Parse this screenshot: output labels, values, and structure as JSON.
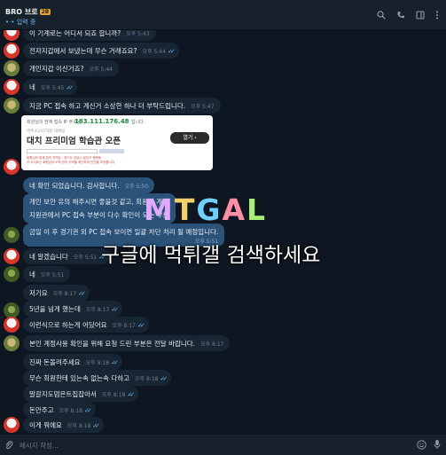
{
  "header": {
    "name": "BRO 브로",
    "badge": "2B",
    "status": "•·• 입력 중"
  },
  "messages": [
    {
      "dir": "in",
      "avatar": "a",
      "text": "이 기계로는 어디서 되죠 합니까?",
      "time": "오후 5:43"
    },
    {
      "dir": "in",
      "avatar": "a",
      "text": "전자지갑에서 보냈는데 무슨 거래죠요?",
      "time": "오후 5:44"
    },
    {
      "dir": "in",
      "avatar": "b",
      "text": "개인지갑 이신거죠?",
      "time": "오후 5:44"
    },
    {
      "dir": "in",
      "avatar": "a",
      "text": "네",
      "time": "오후 5:45"
    },
    {
      "dir": "in",
      "avatar": "b",
      "text": "지금 PC 접속 하고 계신거 소상한 하나 더 부탁드립니다.",
      "time": "오후 5:47"
    },
    {
      "dir": "out",
      "text": "네 확인 되었습니다. 감사합니다.",
      "time": "오후 5:50"
    },
    {
      "dir": "out",
      "text": "개인 보안 유의 해주시면 좋을것 같고, 회원님 계정",
      "time": ""
    },
    {
      "dir": "out",
      "text": "지원관에서 PC 접속 부분이 다수 확인이 되는 부분",
      "time": ""
    },
    {
      "dir": "out",
      "text": "금일 이 후 경기권 외 PC 접속 보이면 일괄 차단 처리 될 예정입니다.",
      "time": "오후 5:51"
    },
    {
      "dir": "in",
      "avatar": "a",
      "text": "네 알겠습니다",
      "time": "오후 5:51"
    },
    {
      "dir": "in",
      "avatar": "c",
      "text": "네",
      "time": "오후 5:51"
    },
    {
      "dir": "in",
      "avatar": "c",
      "text": "저기요",
      "time": "오후 8:17"
    },
    {
      "dir": "in",
      "avatar": "c",
      "text": "5년을 넘게 했는데",
      "time": "오후 8:17"
    },
    {
      "dir": "in",
      "avatar": "a",
      "text": "이런식으로 하는게 어딨어요",
      "time": "오후 8:17"
    },
    {
      "dir": "in",
      "avatar": "b",
      "text": "본인 계정사용 확인을 위해 요청 드린 부분은 전달 바랍니다.",
      "time": "오후 8:17"
    },
    {
      "dir": "in",
      "avatar": "c",
      "text": "진짜 돈돌려주세요",
      "time": "오후 8:18"
    },
    {
      "dir": "in",
      "avatar": "c",
      "text": "무슨 회원한테 있는속 없는속 다하고",
      "time": "오후 8:18"
    },
    {
      "dir": "in",
      "avatar": "c",
      "text": "말갈지도멈은트집잡아서",
      "time": "오후 8:18"
    },
    {
      "dir": "in",
      "avatar": "c",
      "text": "돈안주고",
      "time": "오후 8:18"
    },
    {
      "dir": "in",
      "avatar": "a",
      "text": "이게 뭐에요",
      "time": "오후 8:18"
    }
  ],
  "card": {
    "top_label": "회원님의 현재 접속 IP 주소는",
    "ip": "183.111.176.48",
    "ip_suffix": "입니다.",
    "sub": "역추소247하원 대체범",
    "title": "대치 프리미엄 학습관 오픈",
    "button": "열기 ›",
    "lines": "회원님의 현재 접속 지역은 : 경기도 성남시 분당구 행복동\n이 사이트는 회원님의 IP와 접속 지역을 확인하여 안전을 보장합니다"
  },
  "overlay": {
    "logo": [
      "M",
      "T",
      "G",
      "A",
      "L"
    ],
    "text": "구글에 먹튀갤 검색하세요"
  },
  "composer": {
    "placeholder": "메시지 작성..."
  },
  "icons": [
    "search-icon",
    "phone-icon",
    "sidebar-icon",
    "menu-icon",
    "attach-icon",
    "emoji-icon",
    "mic-icon"
  ]
}
